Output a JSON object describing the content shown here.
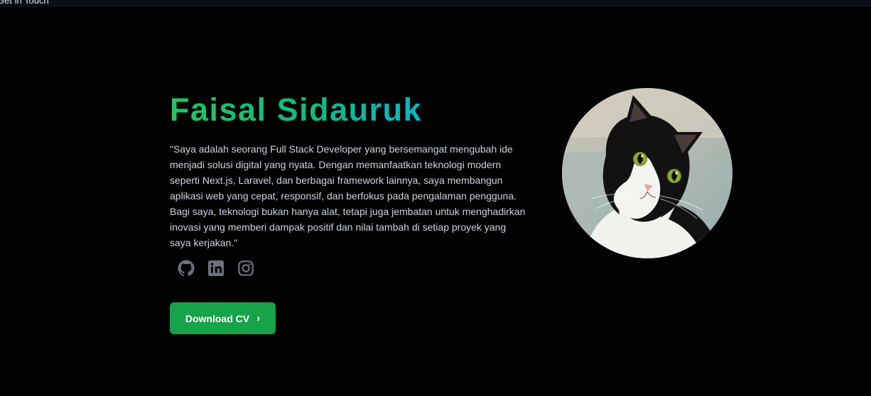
{
  "topbar": {
    "link_text": "Get in Touch"
  },
  "hero": {
    "name": "Faisal Sidauruk",
    "bio": "\"Saya adalah seorang Full Stack Developer yang bersemangat mengubah ide menjadi solusi digital yang nyata. Dengan memanfaatkan teknologi modern seperti Next.js, Laravel, dan berbagai framework lainnya, saya membangun aplikasi web yang cepat, responsif, dan berfokus pada pengalaman pengguna. Bagi saya, teknologi bukan hanya alat, tetapi juga jembatan untuk menghadirkan inovasi yang memberi dampak positif dan nilai tambah di setiap proyek yang saya kerjakan.\"",
    "download_label": "Download CV",
    "download_chevron": "›"
  },
  "socials": [
    {
      "icon": "github-icon"
    },
    {
      "icon": "linkedin-icon"
    },
    {
      "icon": "instagram-icon"
    }
  ],
  "colors": {
    "background": "#000000",
    "accent_green": "#16a34a",
    "gradient_start": "#22c55e",
    "gradient_end": "#0ea5e9",
    "social_icon": "#6b7280",
    "body_text": "#cbd5e1"
  },
  "avatar": {
    "subject": "black-and-white-cat-photo"
  }
}
